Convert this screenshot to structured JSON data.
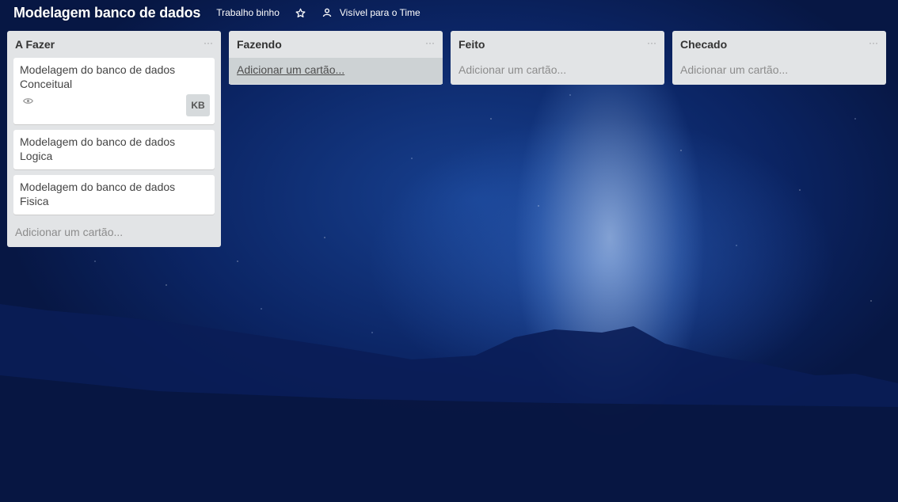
{
  "board": {
    "title": "Modelagem banco de dados",
    "team_label": "Trabalho binho",
    "visibility_label": "Visível para o Time"
  },
  "lists": [
    {
      "title": "A Fazer",
      "menu": "···",
      "cards": [
        {
          "title": "Modelagem do banco de dados Conceitual",
          "avatar": "KB"
        },
        {
          "title": "Modelagem do banco de dados Logica"
        },
        {
          "title": "Modelagem do banco de dados Fisica"
        }
      ],
      "add_card": "Adicionar um cartão..."
    },
    {
      "title": "Fazendo",
      "menu": "···",
      "cards": [],
      "add_card": "Adicionar um cartão..."
    },
    {
      "title": "Feito",
      "menu": "···",
      "cards": [],
      "add_card": "Adicionar um cartão..."
    },
    {
      "title": "Checado",
      "menu": "···",
      "cards": [],
      "add_card": "Adicionar um cartão..."
    }
  ]
}
